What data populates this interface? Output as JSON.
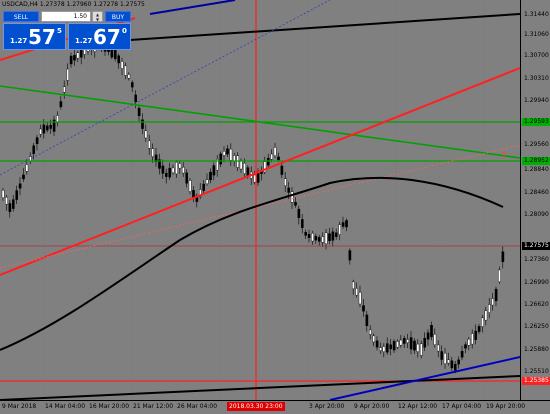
{
  "symbol": {
    "title": "USDCAD,H4  1.27378 1.27960 1.27278 1.27575"
  },
  "trade_panel": {
    "sell_label": "SELL",
    "buy_label": "BUY",
    "lot_value": "1.50",
    "sell_quote": {
      "small": "1.27",
      "big": "57",
      "sup": "5"
    },
    "buy_quote": {
      "small": "1.27",
      "big": "67",
      "sup": "0"
    }
  },
  "price_axis": {
    "labels": [
      "1.31440",
      "1.31060",
      "1.30700",
      "1.30310",
      "1.29940",
      "1.29560",
      "1.28840",
      "1.28460",
      "1.28090",
      "1.27360",
      "1.26990",
      "1.26620",
      "1.26250",
      "1.25880",
      "1.25510"
    ],
    "tags": [
      {
        "text": "1.29593",
        "bg": "#00b000",
        "color": "#000000"
      },
      {
        "text": "1.28952",
        "bg": "#00b000",
        "color": "#000000"
      },
      {
        "text": "1.27575",
        "bg": "#000000",
        "color": "#ffffff"
      },
      {
        "text": "1.25385",
        "bg": "#ff2020",
        "color": "#ffffff"
      }
    ]
  },
  "time_axis": {
    "labels": [
      "9 Mar 2018",
      "14 Mar 04:00",
      "16 Mar 20:00",
      "21 Mar 12:00",
      "26 Mar 04:00",
      "3 Apr 20:00",
      "9 Apr 20:00",
      "12 Apr 12:00",
      "17 Apr 04:00",
      "19 Apr 20:00"
    ],
    "marker": "2018.03.30 23:00"
  },
  "colors": {
    "background": "#808080",
    "bull": "#ffffff",
    "bear": "#000000",
    "support_trend": "#ff2020",
    "resistance_trend": "#00a000",
    "moving_average": "#000000",
    "channel": "#0000a0"
  }
}
